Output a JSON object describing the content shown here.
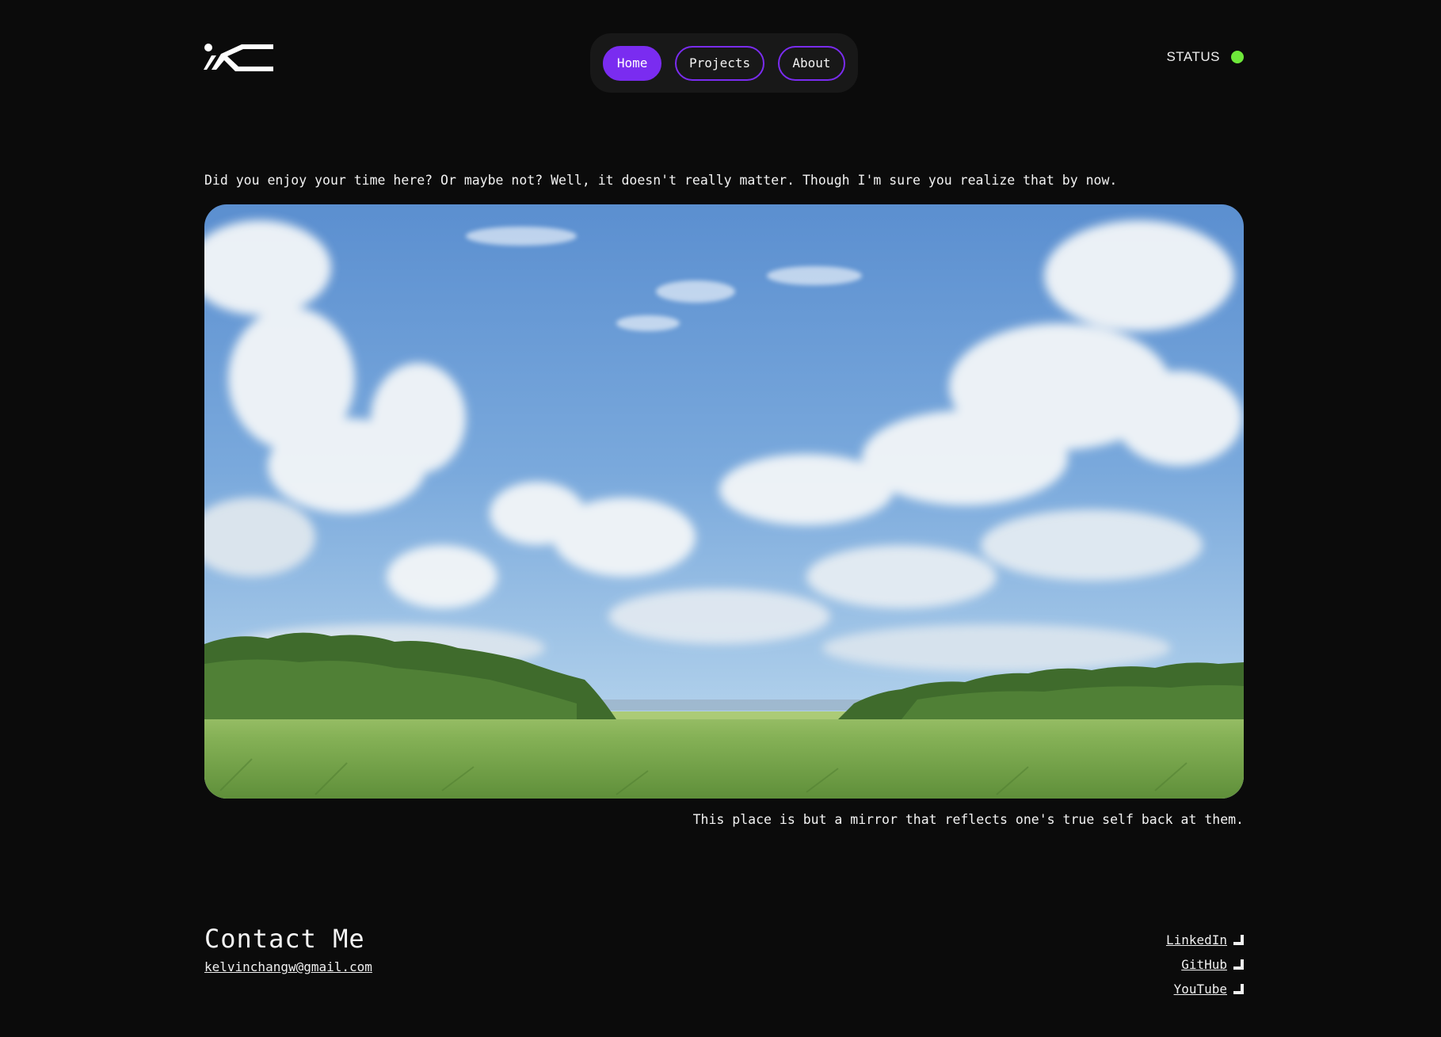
{
  "header": {
    "logo_icon": "kc-monogram-logo",
    "nav": {
      "home": "Home",
      "projects": "Projects",
      "about": "About"
    },
    "status": {
      "label": "STATUS",
      "indicator_color": "#6ee83a"
    }
  },
  "main": {
    "intro": "Did you enjoy your time here? Or maybe not? Well, it doesn't really matter. Though I'm sure you realize that by now.",
    "image_icon": "landscape-painting",
    "caption": "This place is but a mirror that reflects one's true self back at them."
  },
  "footer": {
    "contact_title": "Contact Me",
    "email": "kelvinchangw@gmail.com",
    "links": [
      {
        "label": "LinkedIn",
        "icon": "external-link-icon"
      },
      {
        "label": "GitHub",
        "icon": "external-link-icon"
      },
      {
        "label": "YouTube",
        "icon": "external-link-icon"
      }
    ]
  },
  "colors": {
    "background": "#0b0b0b",
    "accent": "#7a2cf0",
    "status_green": "#6ee83a"
  }
}
